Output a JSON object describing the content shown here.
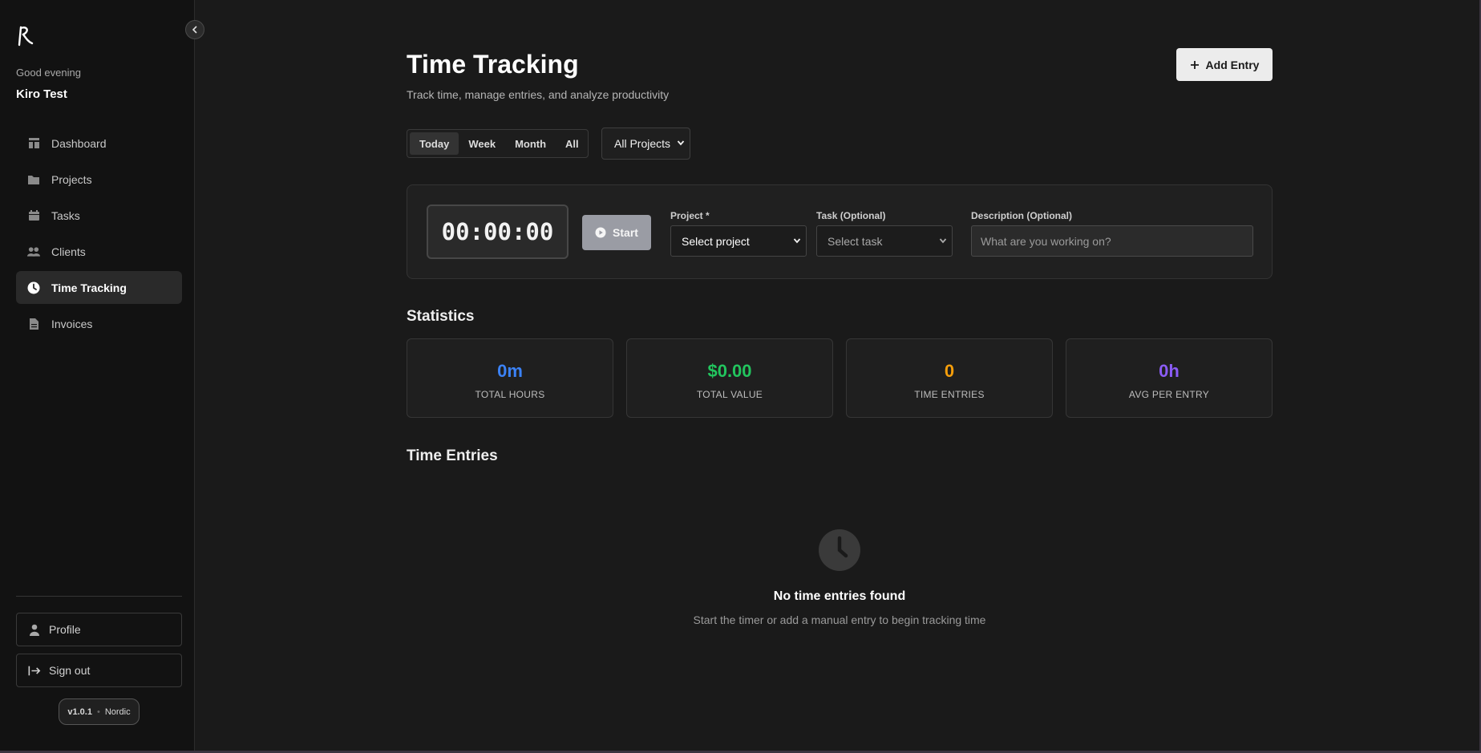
{
  "sidebar": {
    "greeting": "Good evening",
    "user_name": "Kiro Test",
    "items": [
      {
        "label": "Dashboard",
        "icon": "dashboard-icon"
      },
      {
        "label": "Projects",
        "icon": "folder-icon"
      },
      {
        "label": "Tasks",
        "icon": "calendar-icon"
      },
      {
        "label": "Clients",
        "icon": "users-icon"
      },
      {
        "label": "Time Tracking",
        "icon": "clock-icon",
        "active": true
      },
      {
        "label": "Invoices",
        "icon": "document-icon"
      }
    ],
    "profile_label": "Profile",
    "signout_label": "Sign out",
    "version": "v1.0.1",
    "theme": "Nordic"
  },
  "header": {
    "title": "Time Tracking",
    "subtitle": "Track time, manage entries, and analyze productivity",
    "add_entry_label": "Add Entry"
  },
  "filters": {
    "ranges": [
      "Today",
      "Week",
      "Month",
      "All"
    ],
    "active_range": "Today",
    "project_filter": "All Projects"
  },
  "timer": {
    "display": "00:00:00",
    "start_label": "Start",
    "project_label": "Project *",
    "project_placeholder": "Select project",
    "task_label": "Task (Optional)",
    "task_placeholder": "Select task",
    "description_label": "Description (Optional)",
    "description_placeholder": "What are you working on?"
  },
  "statistics": {
    "title": "Statistics",
    "cards": [
      {
        "value": "0m",
        "label": "TOTAL HOURS",
        "color": "#3b82f6"
      },
      {
        "value": "$0.00",
        "label": "TOTAL VALUE",
        "color": "#22c55e"
      },
      {
        "value": "0",
        "label": "TIME ENTRIES",
        "color": "#f59e0b"
      },
      {
        "value": "0h",
        "label": "AVG PER ENTRY",
        "color": "#8b5cf6"
      }
    ]
  },
  "entries": {
    "title": "Time Entries",
    "empty_title": "No time entries found",
    "empty_subtitle": "Start the timer or add a manual entry to begin tracking time"
  }
}
